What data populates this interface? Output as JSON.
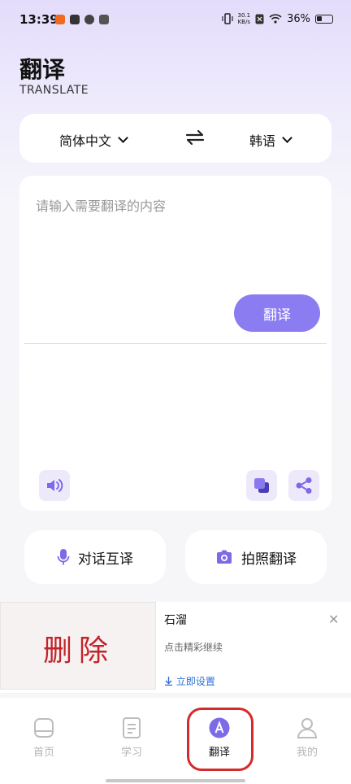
{
  "status_bar": {
    "time": "13:39",
    "net_speed_top": "30.1",
    "net_speed_bottom": "KB/s",
    "battery": "36%"
  },
  "header": {
    "title": "翻译",
    "subtitle": "TRANSLATE"
  },
  "languages": {
    "source": "简体中文",
    "target": "韩语"
  },
  "input": {
    "placeholder": "请输入需要翻译的内容",
    "translate_button": "翻译"
  },
  "actions": {
    "dialogue": "对话互译",
    "photo": "拍照翻译"
  },
  "ad": {
    "image_text": "删除",
    "title": "石溜",
    "description": "点击精彩继续",
    "link": "立即设置"
  },
  "tabs": [
    {
      "label": "首页",
      "icon": "home-icon"
    },
    {
      "label": "学习",
      "icon": "document-icon"
    },
    {
      "label": "翻译",
      "icon": "translate-icon"
    },
    {
      "label": "我的",
      "icon": "user-icon"
    }
  ],
  "colors": {
    "accent": "#8c7cf2",
    "accent_light": "#ede9fb",
    "highlight_border": "#d42a2a"
  }
}
